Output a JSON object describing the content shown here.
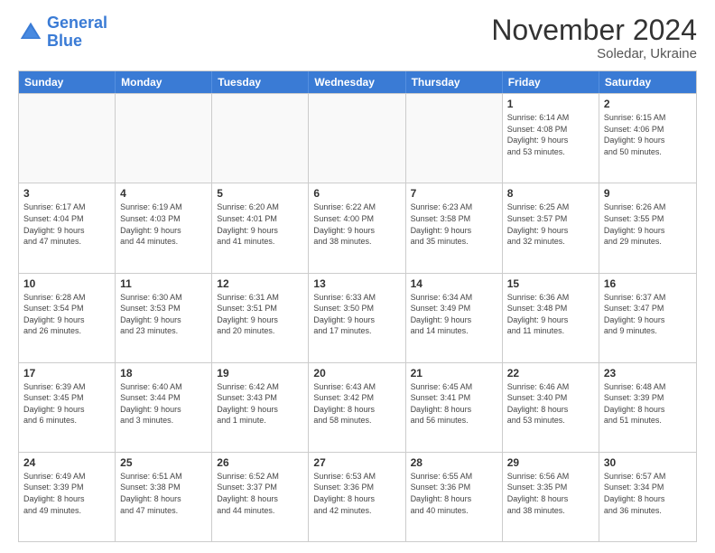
{
  "logo": {
    "line1": "General",
    "line2": "Blue"
  },
  "title": "November 2024",
  "subtitle": "Soledar, Ukraine",
  "days": [
    "Sunday",
    "Monday",
    "Tuesday",
    "Wednesday",
    "Thursday",
    "Friday",
    "Saturday"
  ],
  "rows": [
    [
      {
        "day": "",
        "text": "",
        "empty": true
      },
      {
        "day": "",
        "text": "",
        "empty": true
      },
      {
        "day": "",
        "text": "",
        "empty": true
      },
      {
        "day": "",
        "text": "",
        "empty": true
      },
      {
        "day": "",
        "text": "",
        "empty": true
      },
      {
        "day": "1",
        "text": "Sunrise: 6:14 AM\nSunset: 4:08 PM\nDaylight: 9 hours\nand 53 minutes."
      },
      {
        "day": "2",
        "text": "Sunrise: 6:15 AM\nSunset: 4:06 PM\nDaylight: 9 hours\nand 50 minutes."
      }
    ],
    [
      {
        "day": "3",
        "text": "Sunrise: 6:17 AM\nSunset: 4:04 PM\nDaylight: 9 hours\nand 47 minutes."
      },
      {
        "day": "4",
        "text": "Sunrise: 6:19 AM\nSunset: 4:03 PM\nDaylight: 9 hours\nand 44 minutes."
      },
      {
        "day": "5",
        "text": "Sunrise: 6:20 AM\nSunset: 4:01 PM\nDaylight: 9 hours\nand 41 minutes."
      },
      {
        "day": "6",
        "text": "Sunrise: 6:22 AM\nSunset: 4:00 PM\nDaylight: 9 hours\nand 38 minutes."
      },
      {
        "day": "7",
        "text": "Sunrise: 6:23 AM\nSunset: 3:58 PM\nDaylight: 9 hours\nand 35 minutes."
      },
      {
        "day": "8",
        "text": "Sunrise: 6:25 AM\nSunset: 3:57 PM\nDaylight: 9 hours\nand 32 minutes."
      },
      {
        "day": "9",
        "text": "Sunrise: 6:26 AM\nSunset: 3:55 PM\nDaylight: 9 hours\nand 29 minutes."
      }
    ],
    [
      {
        "day": "10",
        "text": "Sunrise: 6:28 AM\nSunset: 3:54 PM\nDaylight: 9 hours\nand 26 minutes."
      },
      {
        "day": "11",
        "text": "Sunrise: 6:30 AM\nSunset: 3:53 PM\nDaylight: 9 hours\nand 23 minutes."
      },
      {
        "day": "12",
        "text": "Sunrise: 6:31 AM\nSunset: 3:51 PM\nDaylight: 9 hours\nand 20 minutes."
      },
      {
        "day": "13",
        "text": "Sunrise: 6:33 AM\nSunset: 3:50 PM\nDaylight: 9 hours\nand 17 minutes."
      },
      {
        "day": "14",
        "text": "Sunrise: 6:34 AM\nSunset: 3:49 PM\nDaylight: 9 hours\nand 14 minutes."
      },
      {
        "day": "15",
        "text": "Sunrise: 6:36 AM\nSunset: 3:48 PM\nDaylight: 9 hours\nand 11 minutes."
      },
      {
        "day": "16",
        "text": "Sunrise: 6:37 AM\nSunset: 3:47 PM\nDaylight: 9 hours\nand 9 minutes."
      }
    ],
    [
      {
        "day": "17",
        "text": "Sunrise: 6:39 AM\nSunset: 3:45 PM\nDaylight: 9 hours\nand 6 minutes."
      },
      {
        "day": "18",
        "text": "Sunrise: 6:40 AM\nSunset: 3:44 PM\nDaylight: 9 hours\nand 3 minutes."
      },
      {
        "day": "19",
        "text": "Sunrise: 6:42 AM\nSunset: 3:43 PM\nDaylight: 9 hours\nand 1 minute."
      },
      {
        "day": "20",
        "text": "Sunrise: 6:43 AM\nSunset: 3:42 PM\nDaylight: 8 hours\nand 58 minutes."
      },
      {
        "day": "21",
        "text": "Sunrise: 6:45 AM\nSunset: 3:41 PM\nDaylight: 8 hours\nand 56 minutes."
      },
      {
        "day": "22",
        "text": "Sunrise: 6:46 AM\nSunset: 3:40 PM\nDaylight: 8 hours\nand 53 minutes."
      },
      {
        "day": "23",
        "text": "Sunrise: 6:48 AM\nSunset: 3:39 PM\nDaylight: 8 hours\nand 51 minutes."
      }
    ],
    [
      {
        "day": "24",
        "text": "Sunrise: 6:49 AM\nSunset: 3:39 PM\nDaylight: 8 hours\nand 49 minutes."
      },
      {
        "day": "25",
        "text": "Sunrise: 6:51 AM\nSunset: 3:38 PM\nDaylight: 8 hours\nand 47 minutes."
      },
      {
        "day": "26",
        "text": "Sunrise: 6:52 AM\nSunset: 3:37 PM\nDaylight: 8 hours\nand 44 minutes."
      },
      {
        "day": "27",
        "text": "Sunrise: 6:53 AM\nSunset: 3:36 PM\nDaylight: 8 hours\nand 42 minutes."
      },
      {
        "day": "28",
        "text": "Sunrise: 6:55 AM\nSunset: 3:36 PM\nDaylight: 8 hours\nand 40 minutes."
      },
      {
        "day": "29",
        "text": "Sunrise: 6:56 AM\nSunset: 3:35 PM\nDaylight: 8 hours\nand 38 minutes."
      },
      {
        "day": "30",
        "text": "Sunrise: 6:57 AM\nSunset: 3:34 PM\nDaylight: 8 hours\nand 36 minutes."
      }
    ]
  ]
}
